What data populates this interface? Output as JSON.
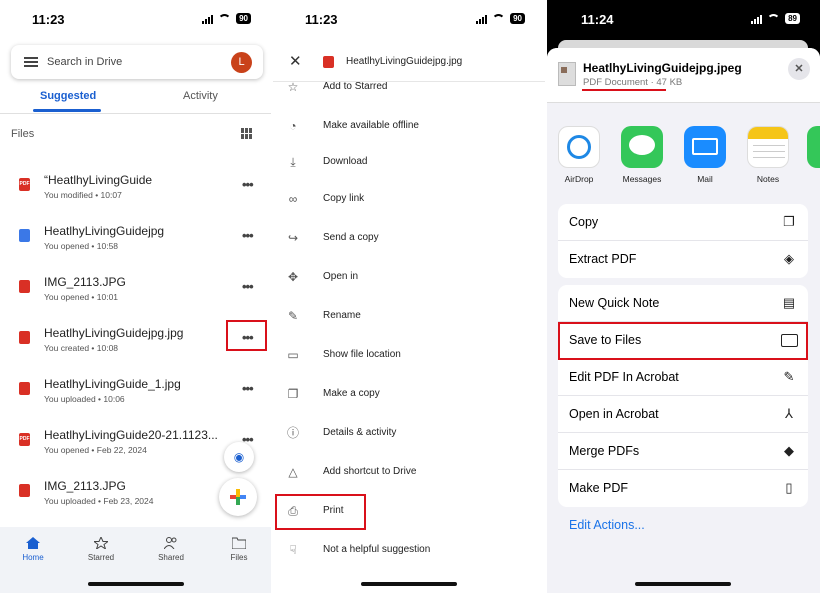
{
  "panel1": {
    "status": {
      "time": "11:23",
      "battery": "90"
    },
    "search": {
      "placeholder": "Search in Drive",
      "avatar": "L"
    },
    "tabs": [
      {
        "label": "Suggested",
        "active": true
      },
      {
        "label": "Activity",
        "active": false
      }
    ],
    "files_label": "Files",
    "files": [
      {
        "name": "“HeatlhyLivingGuide",
        "meta": "You modified • 10:07",
        "icon": "pdf-icon"
      },
      {
        "name": "HeatlhyLivingGuidejpg",
        "meta": "You opened • 10:58",
        "icon": "doc-icon"
      },
      {
        "name": "IMG_2113.JPG",
        "meta": "You opened • 10:01",
        "icon": "image-icon"
      },
      {
        "name": "HeatlhyLivingGuidejpg.jpg",
        "meta": "You created • 10:08",
        "icon": "image-icon"
      },
      {
        "name": "HeatlhyLivingGuide_1.jpg",
        "meta": "You uploaded • 10:06",
        "icon": "image-icon"
      },
      {
        "name": "HeatlhyLivingGuide20-21.1123...",
        "meta": "You opened • Feb 22, 2024",
        "icon": "pdf-icon"
      },
      {
        "name": "IMG_2113.JPG",
        "meta": "You uploaded • Feb 23, 2024",
        "icon": "image-icon"
      }
    ],
    "nav": [
      {
        "label": "Home",
        "icon": "home-icon"
      },
      {
        "label": "Starred",
        "icon": "star-icon"
      },
      {
        "label": "Shared",
        "icon": "people-icon"
      },
      {
        "label": "Files",
        "icon": "folder-icon"
      }
    ],
    "file_icon_labels": {
      "pdf": "PDF"
    }
  },
  "panel2": {
    "status": {
      "time": "11:23",
      "battery": "90"
    },
    "title": "HeatlhyLivingGuidejpg.jpg",
    "menu": [
      {
        "label": "Add to Starred",
        "icon": "star-icon"
      },
      {
        "label": "Make available offline",
        "icon": "offline-icon"
      },
      {
        "label": "Download",
        "icon": "download-icon"
      },
      {
        "label": "Copy link",
        "icon": "link-icon"
      },
      {
        "label": "Send a copy",
        "icon": "share-icon"
      },
      {
        "label": "Open in",
        "icon": "open-in-icon"
      },
      {
        "label": "Rename",
        "icon": "pencil-icon"
      },
      {
        "label": "Show file location",
        "icon": "folder-icon"
      },
      {
        "label": "Make a copy",
        "icon": "copy-icon"
      },
      {
        "label": "Details & activity",
        "icon": "info-icon"
      },
      {
        "label": "Add shortcut to Drive",
        "icon": "shortcut-icon"
      },
      {
        "label": "Print",
        "icon": "print-icon"
      },
      {
        "label": "Not a helpful suggestion",
        "icon": "thumbs-down-icon"
      }
    ]
  },
  "panel3": {
    "status": {
      "time": "11:24",
      "battery": "89"
    },
    "title": "HeatlhyLivingGuidejpg.jpeg",
    "subtitle": "PDF Document · 47 KB",
    "apps": [
      {
        "label": "AirDrop",
        "icon": "airdrop-icon"
      },
      {
        "label": "Messages",
        "icon": "messages-icon"
      },
      {
        "label": "Mail",
        "icon": "mail-icon"
      },
      {
        "label": "Notes",
        "icon": "notes-icon"
      },
      {
        "label": "W",
        "icon": "whatsapp-icon"
      }
    ],
    "group1": [
      {
        "label": "Copy",
        "icon": "copy-icon"
      },
      {
        "label": "Extract PDF",
        "icon": "layers-icon"
      }
    ],
    "group2": [
      {
        "label": "New Quick Note",
        "icon": "quick-note-icon"
      },
      {
        "label": "Save to Files",
        "icon": "folder-icon"
      },
      {
        "label": "Edit PDF In Acrobat",
        "icon": "edit-icon"
      },
      {
        "label": "Open in Acrobat",
        "icon": "acrobat-icon"
      },
      {
        "label": "Merge PDFs",
        "icon": "merge-icon"
      },
      {
        "label": "Make PDF",
        "icon": "document-icon"
      }
    ],
    "edit_actions": "Edit Actions..."
  },
  "colors": {
    "highlight": "#d9101a",
    "drive_blue": "#1a5fd0",
    "ios_link": "#1a73e8"
  }
}
